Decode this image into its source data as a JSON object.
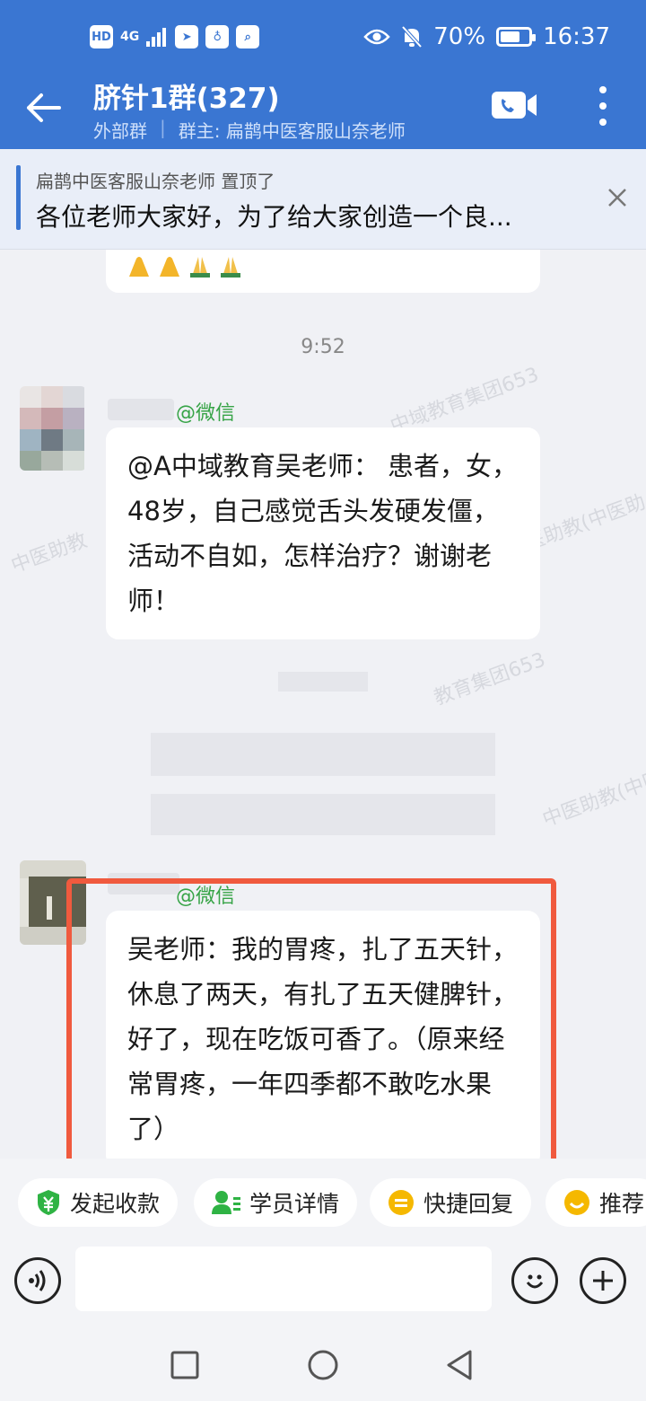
{
  "status_bar": {
    "hd": "HD",
    "network": "4G",
    "battery_percent": "70%",
    "battery_level": 0.7,
    "time": "16:37"
  },
  "header": {
    "title": "脐针1群(327)",
    "group_type": "外部群",
    "owner": "群主: 扁鹊中医客服山奈老师"
  },
  "pinned": {
    "meta": "扁鹊中医客服山奈老师 置顶了",
    "text": "各位老师大家好，为了给大家创造一个良..."
  },
  "chat": {
    "time_divider": "9:52",
    "messages": [
      {
        "tag": "@微信",
        "text": "@A中域教育吴老师： 患者，女，48岁，自己感觉舌头发硬发僵，活动不自如，怎样治疗？谢谢老师！"
      },
      {
        "tag": "@微信",
        "text": "吴老师：我的胃疼，扎了五天针，休息了两天，有扎了五天健脾针，好了，现在吃饭可香了。（原来经常胃疼，一年四季都不敢吃水果了）"
      }
    ],
    "watermarks": [
      "中域教育集团653",
      "中医助教(中医助",
      "中医助教",
      "教育集团653",
      "中医助教(中医助"
    ]
  },
  "quick_actions": [
    {
      "label": "发起收款",
      "icon": "payment-icon",
      "color": "#2fb344"
    },
    {
      "label": "学员详情",
      "icon": "student-icon",
      "color": "#2fb344"
    },
    {
      "label": "快捷回复",
      "icon": "quick-reply-icon",
      "color": "#f5b800"
    },
    {
      "label": "推荐",
      "icon": "recommend-icon",
      "color": "#f5b800"
    }
  ],
  "colors": {
    "accent": "#3a76d2",
    "highlight": "#f05a3e",
    "wechat_green": "#37a447"
  }
}
